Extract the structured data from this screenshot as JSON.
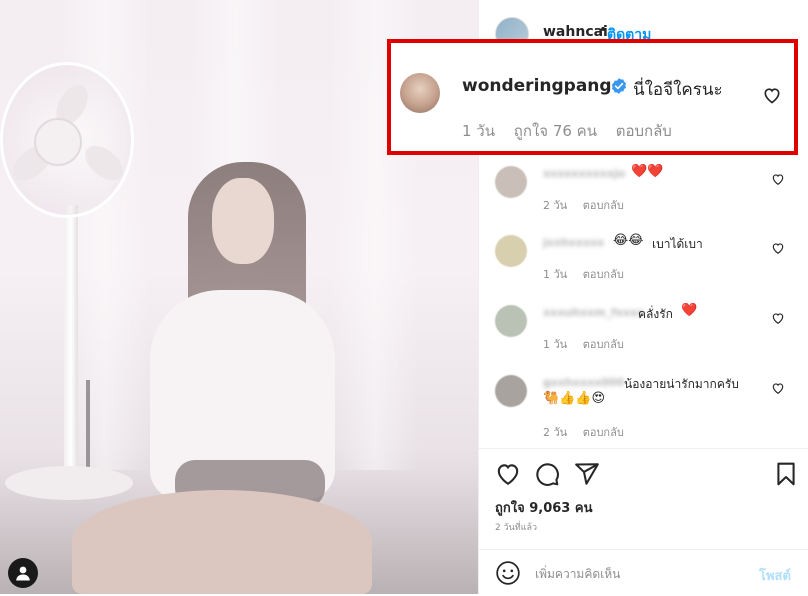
{
  "header": {
    "username": "wahncai",
    "separator": "•",
    "follow_label": "ติดตาม"
  },
  "highlighted_comment": {
    "username": "wonderingpango",
    "verified": true,
    "text": "นี่ใอจีใครนะ",
    "time": "1 วัน",
    "likes": "ถูกใจ 76 คน",
    "reply_label": "ตอบกลับ",
    "highlight_color": "#e00000"
  },
  "comments": [
    {
      "username": "xxxxxxxxxxjo",
      "text": "",
      "emoji": "❤️❤️",
      "time": "2 วัน",
      "reply_label": "ตอบกลับ"
    },
    {
      "username": "jxxhxxxxx",
      "text": "เบาได้เบา",
      "emoji": "😂😂",
      "time": "1 วัน",
      "reply_label": "ตอบกลับ"
    },
    {
      "username": "xxxuhxxm_fxxxx",
      "text": "คลั่งรัก",
      "emoji": "❤️",
      "time": "1 วัน",
      "reply_label": "ตอบกลับ"
    },
    {
      "username": "gxxhxxxx000",
      "text": "น้องอายน่ารักมากครับ",
      "emoji": "🐫👍👍😍",
      "time": "2 วัน",
      "reply_label": "ตอบกลับ"
    }
  ],
  "actions": {
    "likes": "ถูกใจ 9,063 คน",
    "posted": "2 วันที่แล้ว"
  },
  "add_comment": {
    "placeholder": "เพิ่มความคิดเห็น",
    "post_label": "โพสต์"
  },
  "icons": {
    "like": "heart-icon",
    "comment": "comment-icon",
    "share": "share-icon",
    "save": "bookmark-icon",
    "emoji": "smiley-icon",
    "tag": "user-tag-icon",
    "verified": "verified-badge-icon"
  },
  "colors": {
    "accent": "#0095f6",
    "post_disabled": "#b2dffc",
    "heart_red": "#ed4956"
  }
}
